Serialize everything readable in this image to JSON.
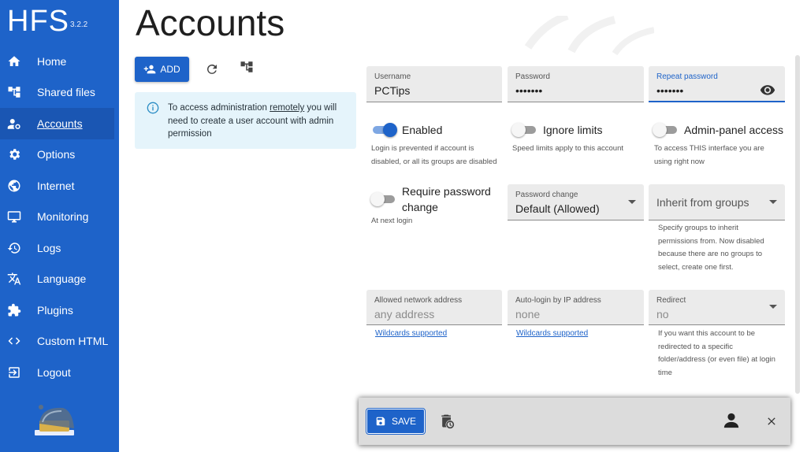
{
  "app": {
    "name": "HFS",
    "version": "3.2.2"
  },
  "sidebar": {
    "items": [
      {
        "label": "Home",
        "icon": "home-icon"
      },
      {
        "label": "Shared files",
        "icon": "tree-icon"
      },
      {
        "label": "Accounts",
        "icon": "accounts-icon",
        "active": true
      },
      {
        "label": "Options",
        "icon": "gear-icon"
      },
      {
        "label": "Internet",
        "icon": "globe-icon"
      },
      {
        "label": "Monitoring",
        "icon": "monitor-icon"
      },
      {
        "label": "Logs",
        "icon": "history-icon"
      },
      {
        "label": "Language",
        "icon": "translate-icon"
      },
      {
        "label": "Plugins",
        "icon": "puzzle-icon"
      },
      {
        "label": "Custom HTML",
        "icon": "code-icon"
      },
      {
        "label": "Logout",
        "icon": "logout-icon"
      }
    ]
  },
  "main": {
    "title": "Accounts",
    "add_label": "ADD",
    "info": {
      "before": "To access administration ",
      "link": "remotely",
      "after": " you will need to create a user account with admin permission"
    }
  },
  "form": {
    "username": {
      "label": "Username",
      "value": "PCTips"
    },
    "password": {
      "label": "Password",
      "value": "•••••••"
    },
    "repeat_password": {
      "label": "Repeat password",
      "value": "•••••••"
    },
    "enabled": {
      "label": "Enabled",
      "on": true,
      "help": "Login is prevented if account is disabled, or all its groups are disabled"
    },
    "ignore_limits": {
      "label": "Ignore limits",
      "on": false,
      "help": "Speed limits apply to this account"
    },
    "admin_access": {
      "label": "Admin-panel access",
      "on": false,
      "help": "To access THIS interface you are using right now"
    },
    "require_password_change": {
      "label": "Require password change",
      "on": false,
      "help": "At next login"
    },
    "password_change": {
      "label": "Password change",
      "value": "Default (Allowed)"
    },
    "inherit_groups": {
      "placeholder": "Inherit from groups",
      "help": "Specify groups to inherit permissions from. Now disabled because there are no groups to select, create one first."
    },
    "allowed_network": {
      "label": "Allowed network address",
      "placeholder": "any address",
      "link": "Wildcards supported"
    },
    "autologin_ip": {
      "label": "Auto-login by IP address",
      "placeholder": "none",
      "link": "Wildcards supported"
    },
    "redirect": {
      "label": "Redirect",
      "placeholder": "no",
      "help": "If you want this account to be redirected to a specific folder/address (or even file) at login time"
    }
  },
  "bottombar": {
    "save_label": "SAVE"
  },
  "colors": {
    "accent": "#1e63c9",
    "sidebar": "#1e63c9",
    "info_bg": "#e5f4fb"
  }
}
